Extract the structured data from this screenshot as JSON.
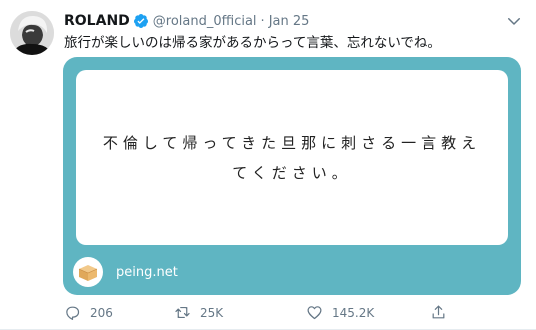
{
  "tweet": {
    "author_name": "ROLAND",
    "handle": "@roland_0fficial",
    "separator": "·",
    "date": "Jan 25",
    "text": "旅行が楽しいのは帰る家があるからって言葉、忘れないでね。"
  },
  "media": {
    "question": "不倫して帰ってきた旦那に刺さる一言教えてください。",
    "brand": "peing.net",
    "background_color": "#5fb5c2"
  },
  "actions": {
    "reply_count": "206",
    "retweet_count": "25K",
    "like_count": "145.2K"
  },
  "icons": [
    "verified-badge-icon",
    "chevron-down-icon",
    "reply-icon",
    "retweet-icon",
    "heart-icon",
    "share-icon",
    "peing-box-icon"
  ],
  "colors": {
    "verified": "#1da1f2",
    "secondary_text": "#657786"
  }
}
